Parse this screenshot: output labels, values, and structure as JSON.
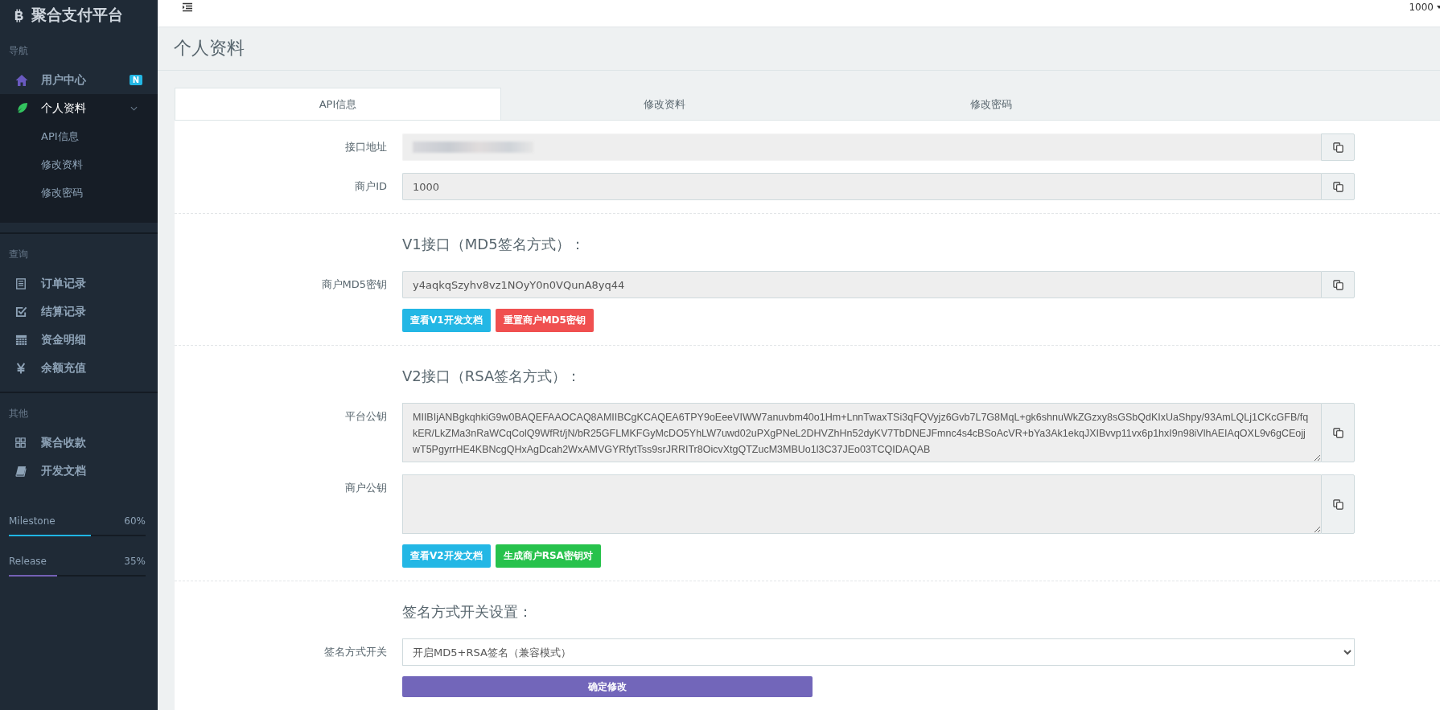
{
  "brand": {
    "title": "聚合支付平台"
  },
  "topbar": {
    "user": "1000"
  },
  "sidebar": {
    "sections": [
      {
        "heading": "导航",
        "items": [
          {
            "label": "用户中心",
            "badge": "N",
            "selected": false
          },
          {
            "label": "个人资料",
            "selected": true,
            "expanded": true,
            "children": [
              {
                "label": "API信息"
              },
              {
                "label": "修改资料"
              },
              {
                "label": "修改密码"
              }
            ]
          }
        ]
      },
      {
        "heading": "查询",
        "items": [
          {
            "label": "订单记录",
            "selected": false
          },
          {
            "label": "结算记录",
            "selected": false
          },
          {
            "label": "资金明细",
            "selected": false
          },
          {
            "label": "余额充值",
            "selected": false
          }
        ]
      },
      {
        "heading": "其他",
        "items": [
          {
            "label": "聚合收款",
            "selected": false
          },
          {
            "label": "开发文档",
            "selected": false
          }
        ]
      }
    ],
    "progress": [
      {
        "label": "Milestone",
        "reading": "60%",
        "level": 0.6,
        "color": "#1fb5e3"
      },
      {
        "label": "Release",
        "reading": "35%",
        "level": 0.35,
        "color": "#7460b5"
      }
    ]
  },
  "page_title": "个人资料",
  "tabs": [
    {
      "label": "API信息",
      "selected": true
    },
    {
      "label": "修改资料",
      "selected": false
    },
    {
      "label": "修改密码",
      "selected": false
    }
  ],
  "sections": [
    {
      "fields": [
        {
          "kind": "redacted",
          "label": "接口地址"
        },
        {
          "kind": "input",
          "label": "商户ID",
          "value": "1000"
        }
      ]
    },
    {
      "heading": "V1接口（MD5签名方式）：",
      "fields": [
        {
          "kind": "input",
          "label": "商户MD5密钥",
          "value": "y4aqkqSzyhv8vz1NOyY0n0VQunA8yq44"
        }
      ],
      "buttons": [
        {
          "label": "查看V1开发文档",
          "kind": "info"
        },
        {
          "label": "重置商户MD5密钥",
          "kind": "danger"
        }
      ]
    },
    {
      "heading": "V2接口（RSA签名方式）：",
      "fields": [
        {
          "kind": "textarea",
          "label": "平台公钥",
          "value": "MIIBIjANBgkqhkiG9w0BAQEFAAOCAQ8AMIIBCgKCAQEA6TPY9oEeeVIWW7anuvbm40o1Hm+LnnTwaxTSi3qFQVyjz6Gvb7L7G8MqL+gk6shnuWkZGzxy8sGSbQdKIxUaShpy/93AmLQLj1CKcGFB/fqkER/LkZMa3nRaWCqColQ9WfRt/jN/bR25GFLMKFGyMcDO5YhLW7uwd02uPXgPNeL2DHVZhHn52dyKV7TbDNEJFmnc4s4cBSoAcVR+bYa3Ak1ekqJXIBvvp11vx6p1hxI9n98iVlhAEIAqOXL9v6gCEojjwT5PgyrrHE4KBNcgQHxAgDcah2WxAMVGYRfytTss9srJRRITr8OicvXtgQTZucM3MBUo1l3C37JEo03TCQIDAQAB"
        },
        {
          "kind": "textarea",
          "label": "商户公钥"
        }
      ],
      "buttons": [
        {
          "label": "查看V2开发文档",
          "kind": "info"
        },
        {
          "label": "生成商户RSA密钥对",
          "kind": "success"
        }
      ]
    },
    {
      "heading": "签名方式开关设置：",
      "fields": [
        {
          "kind": "select",
          "label": "签名方式开关",
          "value": "开启MD5+RSA签名（兼容模式）"
        }
      ],
      "buttons": [
        {
          "label": "确定修改",
          "kind": "primary"
        }
      ]
    }
  ]
}
